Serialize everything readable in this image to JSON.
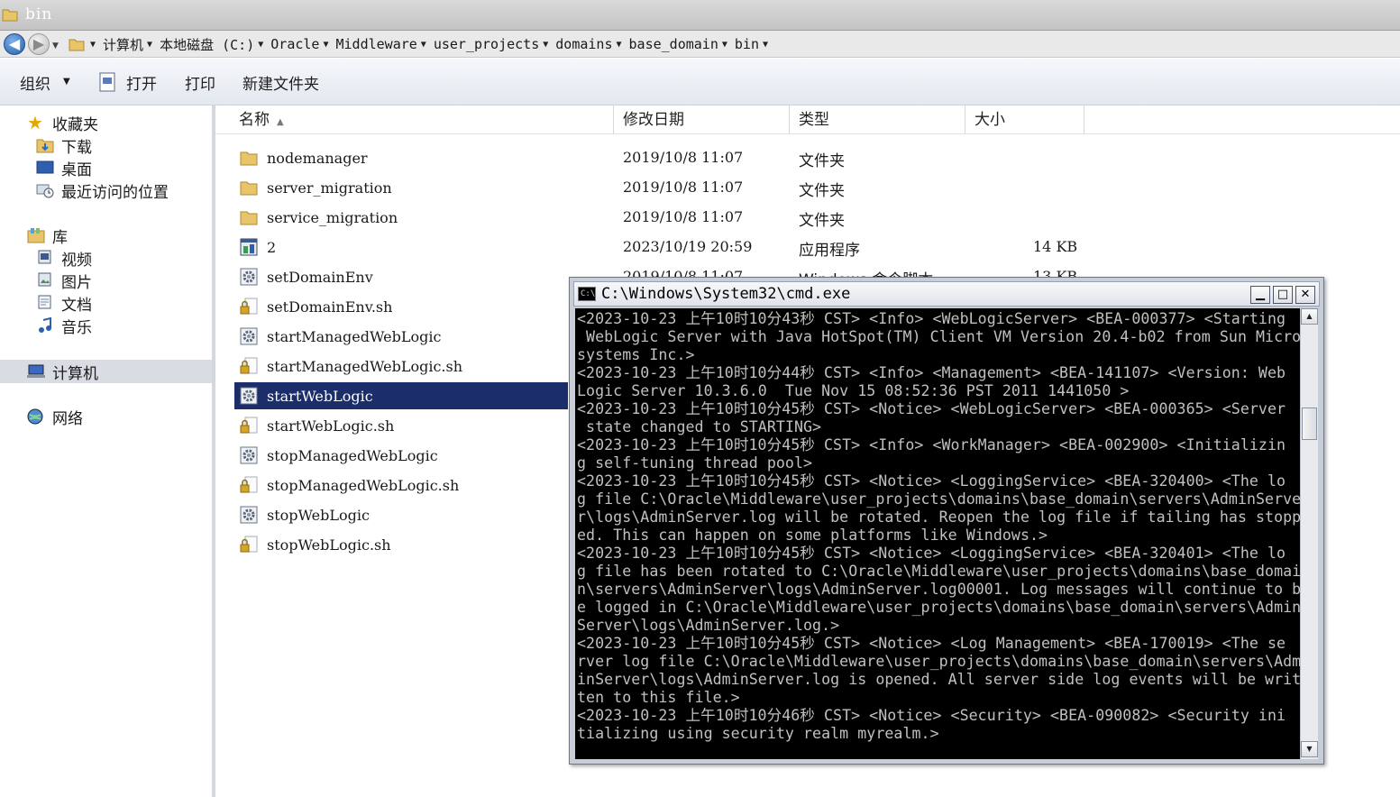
{
  "window": {
    "title": "bin"
  },
  "address_bar": {
    "crumbs": [
      "计算机",
      "本地磁盘 (C:)",
      "Oracle",
      "Middleware",
      "user_projects",
      "domains",
      "base_domain",
      "bin"
    ]
  },
  "toolbar": {
    "organize_label": "组织",
    "open_label": "打开",
    "print_label": "打印",
    "new_folder_label": "新建文件夹"
  },
  "nav": {
    "favorites": {
      "label": "收藏夹",
      "items": [
        "下载",
        "桌面",
        "最近访问的位置"
      ]
    },
    "libraries": {
      "label": "库",
      "items": [
        "视频",
        "图片",
        "文档",
        "音乐"
      ]
    },
    "computer": "计算机",
    "network": "网络"
  },
  "columns": {
    "name": "名称",
    "date": "修改日期",
    "type": "类型",
    "size": "大小"
  },
  "files": [
    {
      "name": "nodemanager",
      "date": "2019/10/8 11:07",
      "type": "文件夹",
      "size": "",
      "icon": "folder-icon"
    },
    {
      "name": "server_migration",
      "date": "2019/10/8 11:07",
      "type": "文件夹",
      "size": "",
      "icon": "folder-icon"
    },
    {
      "name": "service_migration",
      "date": "2019/10/8 11:07",
      "type": "文件夹",
      "size": "",
      "icon": "folder-icon"
    },
    {
      "name": "2",
      "date": "2023/10/19 20:59",
      "type": "应用程序",
      "size": "14 KB",
      "icon": "application-icon"
    },
    {
      "name": "setDomainEnv",
      "date": "2019/10/8 11:07",
      "type": "Windows 命令脚本",
      "size": "13 KB",
      "icon": "gear-script-icon"
    },
    {
      "name": "setDomainEnv.sh",
      "icon": "lock-file-icon"
    },
    {
      "name": "startManagedWebLogic",
      "icon": "gear-script-icon"
    },
    {
      "name": "startManagedWebLogic.sh",
      "icon": "lock-file-icon"
    },
    {
      "name": "startWebLogic",
      "icon": "gear-script-icon",
      "selected": true
    },
    {
      "name": "startWebLogic.sh",
      "icon": "lock-file-icon"
    },
    {
      "name": "stopManagedWebLogic",
      "icon": "gear-script-icon"
    },
    {
      "name": "stopManagedWebLogic.sh",
      "icon": "lock-file-icon"
    },
    {
      "name": "stopWebLogic",
      "icon": "gear-script-icon"
    },
    {
      "name": "stopWebLogic.sh",
      "icon": "lock-file-icon"
    }
  ],
  "cmd": {
    "title": "C:\\Windows\\System32\\cmd.exe",
    "output_lines": [
      "<2023-10-23 上午10时10分43秒 CST> <Info> <WebLogicServer> <BEA-000377> <Starting",
      " WebLogic Server with Java HotSpot(TM) Client VM Version 20.4-b02 from Sun Micro",
      "systems Inc.>",
      "<2023-10-23 上午10时10分44秒 CST> <Info> <Management> <BEA-141107> <Version: Web",
      "Logic Server 10.3.6.0  Tue Nov 15 08:52:36 PST 2011 1441050 >",
      "<2023-10-23 上午10时10分45秒 CST> <Notice> <WebLogicServer> <BEA-000365> <Server",
      " state changed to STARTING>",
      "<2023-10-23 上午10时10分45秒 CST> <Info> <WorkManager> <BEA-002900> <Initializin",
      "g self-tuning thread pool>",
      "<2023-10-23 上午10时10分45秒 CST> <Notice> <LoggingService> <BEA-320400> <The lo",
      "g file C:\\Oracle\\Middleware\\user_projects\\domains\\base_domain\\servers\\AdminServe",
      "r\\logs\\AdminServer.log will be rotated. Reopen the log file if tailing has stopp",
      "ed. This can happen on some platforms like Windows.>",
      "<2023-10-23 上午10时10分45秒 CST> <Notice> <LoggingService> <BEA-320401> <The lo",
      "g file has been rotated to C:\\Oracle\\Middleware\\user_projects\\domains\\base_domai",
      "n\\servers\\AdminServer\\logs\\AdminServer.log00001. Log messages will continue to b",
      "e logged in C:\\Oracle\\Middleware\\user_projects\\domains\\base_domain\\servers\\Admin",
      "Server\\logs\\AdminServer.log.>",
      "<2023-10-23 上午10时10分45秒 CST> <Notice> <Log Management> <BEA-170019> <The se",
      "rver log file C:\\Oracle\\Middleware\\user_projects\\domains\\base_domain\\servers\\Adm",
      "inServer\\logs\\AdminServer.log is opened. All server side log events will be writ",
      "ten to this file.>",
      "<2023-10-23 上午10时10分46秒 CST> <Notice> <Security> <BEA-090082> <Security ini",
      "tializing using security realm myrealm.>"
    ]
  }
}
